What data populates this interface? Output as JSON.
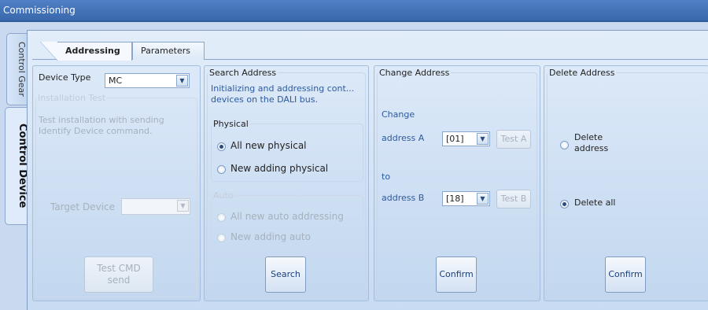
{
  "window": {
    "title": "Commissioning"
  },
  "side_tabs": {
    "control_gear": "Control Gear",
    "control_device": "Control Device"
  },
  "tabs": {
    "addressing": "Addressing",
    "parameters": "Parameters"
  },
  "device_type": {
    "label": "Device Type",
    "value": "MC"
  },
  "installation_test": {
    "legend": "Installation Test",
    "description": "Test installation with sending Identify Device command.",
    "target_label": "Target Device",
    "target_value": "",
    "button": "Test CMD send"
  },
  "search_address": {
    "legend": "Search Address",
    "description": "Initializing and addressing cont... devices on the DALI bus.",
    "physical_legend": "Physical",
    "all_new_physical": "All new physical",
    "new_adding_physical": "New adding physical",
    "auto_legend": "Auto",
    "all_new_auto": "All new auto addressing",
    "new_adding_auto": "New adding auto",
    "button": "Search"
  },
  "change_address": {
    "legend": "Change Address",
    "change_label": "Change",
    "address_a_label": "address A",
    "address_a_value": "[01]",
    "test_a": "Test A",
    "to_label": "to",
    "address_b_label": "address B",
    "address_b_value": "[18]",
    "test_b": "Test B",
    "button": "Confirm"
  },
  "delete_address": {
    "legend": "Delete Address",
    "delete_address_label": "Delete address",
    "delete_all_label": "Delete all",
    "button": "Confirm"
  }
}
